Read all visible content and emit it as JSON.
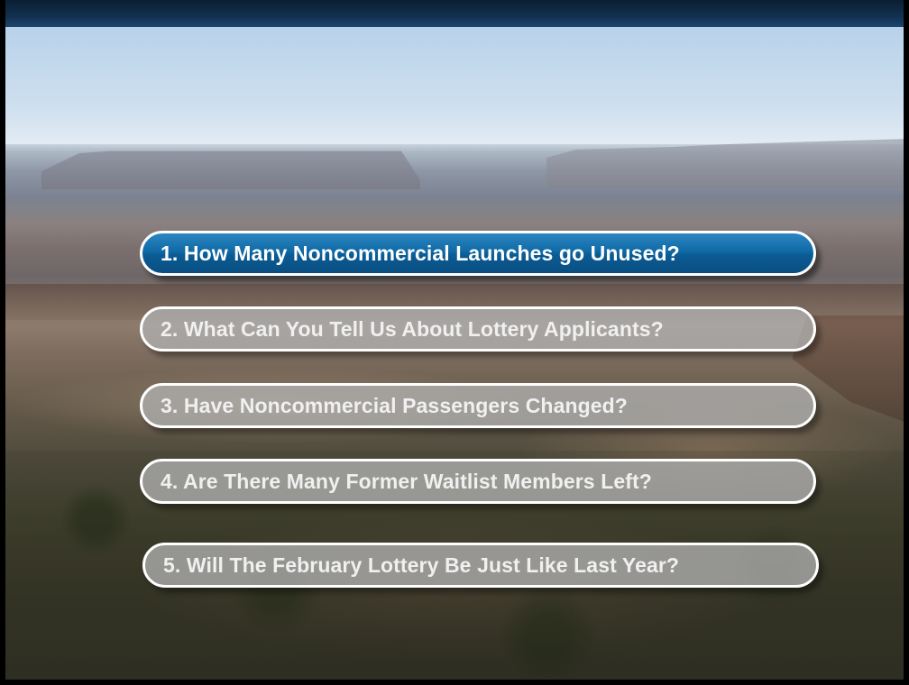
{
  "menu": {
    "items": [
      {
        "label": "1. How Many Noncommercial Launches go Unused?",
        "active": true
      },
      {
        "label": "2. What Can You Tell Us About Lottery Applicants?",
        "active": false
      },
      {
        "label": "3. Have Noncommercial Passengers Changed?",
        "active": false
      },
      {
        "label": "4. Are There Many Former Waitlist Members Left?",
        "active": false
      },
      {
        "label": "5. Will The February Lottery Be Just Like Last Year?",
        "active": false
      }
    ]
  },
  "colors": {
    "active_button": "#0f6aa6",
    "inactive_button": "#afafaf",
    "button_border": "#ffffff",
    "header_bar": "#12304f"
  }
}
